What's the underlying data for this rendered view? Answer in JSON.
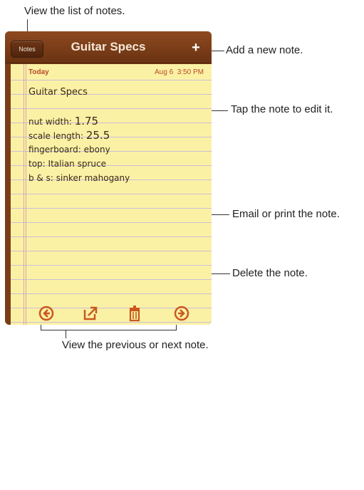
{
  "callouts": {
    "list": "View the list of notes.",
    "add": "Add a new note.",
    "tap": "Tap the note to edit it.",
    "email": "Email or print the note.",
    "delete": "Delete the note.",
    "prevnext": "View the previous or next note."
  },
  "navbar": {
    "notes_button": "Notes",
    "title": "Guitar Specs",
    "add_glyph": "+"
  },
  "note": {
    "date_label": "Today",
    "date_value": "Aug 6",
    "time_value": "3:50 PM",
    "title": "Guitar Specs",
    "lines": [
      {
        "label": "nut width:",
        "value": "1.75"
      },
      {
        "label": "scale length:",
        "value": "25.5"
      },
      {
        "label": "fingerboard:",
        "value": "ebony"
      },
      {
        "label": "top:",
        "value": "Italian spruce"
      },
      {
        "label": "b & s:",
        "value": "sinker mahogany"
      }
    ]
  },
  "toolbar": {
    "icons": [
      "previous-note-icon",
      "share-icon",
      "trash-icon",
      "next-note-icon"
    ],
    "accent": "#c9581e"
  },
  "colors": {
    "navbar": "#7a3d17",
    "paper": "#fbf1a5",
    "date_text": "#b84a2a"
  }
}
